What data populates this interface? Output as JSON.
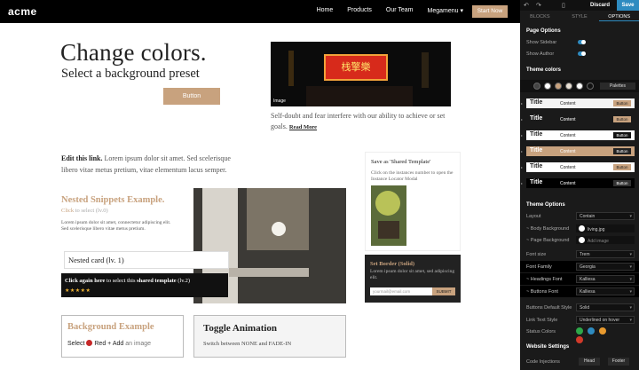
{
  "nav": {
    "logo": "acme",
    "links": [
      "Home",
      "Products",
      "Our Team",
      "Megamenu ▾"
    ],
    "cta": "Start Now"
  },
  "hero": {
    "title": "Change colors.",
    "subtitle": "Select a background preset",
    "button": "Button",
    "image_caption": "Image",
    "sign_text": "栈擎樂",
    "text": "Self-doubt and fear interfere with our ability to achieve or set goals.",
    "read_more": "Read More"
  },
  "edit": {
    "bold": "Edit this link.",
    "text": "Lorem ipsum dolor sit amet. Sed scelerisque libero vitae metus pretium, vitae elementum lacus semper."
  },
  "nested": {
    "title": "Nested Snippets Example.",
    "click_link": "Click",
    "click_rest": "to select (lv.0)",
    "lorem": "Lorem ipsum dolor sit amet, connectetur adipiscing elit. Sed scelerisque libero vitae metus pretium.",
    "card_lv1": "Nested card (lv. 1)",
    "click_again": "Click again here",
    "to_select": "to select this",
    "shared_template": "shared template",
    "lv2": "(lv.2)",
    "stars": "★★★★★"
  },
  "save_card": {
    "title": "Save as 'Shared Template'",
    "desc": "Click on the instances number to open the Instance Locator Modal"
  },
  "set_border": {
    "title": "Set Border (Solid)",
    "desc": "Lorem ipsum dolor sit amet, sed adipiscing elit.",
    "input_placeholder": "yourmail@email.com",
    "submit": "SUBMIT"
  },
  "bg_example": {
    "title": "Background Example",
    "select": "Select",
    "red": "Red",
    "add": "+ Add",
    "rest": "an image"
  },
  "toggle_anim": {
    "title": "Toggle Animation",
    "text": "Switch between NONE and FADE-IN"
  },
  "panel": {
    "undo": "↶",
    "redo": "↷",
    "device": "▯",
    "discard": "Discard",
    "save": "Save",
    "tabs": [
      "BLOCKS",
      "STYLE",
      "OPTIONS"
    ],
    "active_tab": "OPTIONS",
    "page_options": "Page Options",
    "show_sidebar": "Show Sidebar",
    "show_author": "Show Author",
    "theme_colors": "Theme colors",
    "palettes": "Palettes",
    "swatches": [
      "#444444",
      "#ffffff",
      "#c8a27e",
      "#e8e0d4",
      "#ffffff",
      "#111111"
    ],
    "theme_rows": [
      {
        "title": "Title",
        "content": "Content",
        "button": "Button",
        "bg": "#f4f4f4",
        "fg": "#222222",
        "btn_bg": "#c8a27e",
        "btn_fg": "#222222"
      },
      {
        "title": "Title",
        "content": "Content",
        "button": "Button",
        "bg": "#1a1a1a",
        "fg": "#ffffff",
        "btn_bg": "#c8a27e",
        "btn_fg": "#222222"
      },
      {
        "title": "Title",
        "content": "Content",
        "button": "Button",
        "bg": "#ffffff",
        "fg": "#222222",
        "btn_bg": "#111111",
        "btn_fg": "#ffffff"
      },
      {
        "title": "Title",
        "content": "Content",
        "button": "Button",
        "bg": "#c8a27e",
        "fg": "#ffffff",
        "btn_bg": "#222222",
        "btn_fg": "#ffffff"
      },
      {
        "title": "Title",
        "content": "Content",
        "button": "Button",
        "bg": "#ffffff",
        "fg": "#222222",
        "btn_bg": "#c8a27e",
        "btn_fg": "#222222"
      },
      {
        "title": "Title",
        "content": "Content",
        "button": "Button",
        "bg": "#000000",
        "fg": "#ffffff",
        "btn_bg": "#333333",
        "btn_fg": "#ffffff"
      }
    ],
    "theme_options": "Theme Options",
    "layout_label": "Layout",
    "layout_value": "Contain",
    "body_bg_label": "~ Body Background",
    "body_bg_value": "living.jpg",
    "page_bg_label": "~ Page Background",
    "page_bg_value": "Add image",
    "font_size_label": "Font size",
    "font_size_value": "Trem",
    "font_family_label": "Font Family",
    "font_family_value": "Georgia",
    "headings_font_label": "~ Headings Font",
    "headings_font_value": "Kalliesa",
    "buttons_font_label": "~ Buttons Font",
    "buttons_font_value": "Kalliesa",
    "buttons_style_label": "Buttons Default Style",
    "buttons_style_value": "Solid",
    "link_style_label": "Link Text Style",
    "link_style_value": "Underlined on hover",
    "status_colors_label": "Status Colors",
    "status_colors": [
      "#2ea84a",
      "#2e8bc0",
      "#e89a2e",
      "#d23a2a"
    ],
    "website_settings": "Website Settings",
    "code_injections": "Code Injections",
    "head": "Head",
    "footer": "Footer"
  }
}
